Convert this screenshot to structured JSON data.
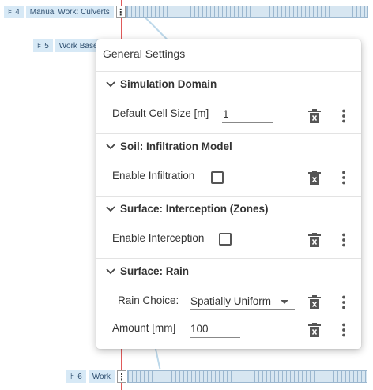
{
  "gantt": {
    "rows": [
      {
        "id": "row-4",
        "symbol": "⊧",
        "number": "4",
        "label": "Manual Work: Culverts"
      },
      {
        "id": "row-5",
        "symbol": "⊧",
        "number": "5",
        "label": "Work Base"
      },
      {
        "id": "row-6",
        "symbol": "⊧",
        "number": "6",
        "label": "Work"
      }
    ]
  },
  "panel": {
    "title": "General Settings",
    "sections": [
      {
        "title": "Simulation Domain",
        "fields": [
          {
            "label": "Default Cell Size [m]",
            "type": "input",
            "value": "1"
          }
        ]
      },
      {
        "title": "Soil: Infiltration Model",
        "fields": [
          {
            "label": "Enable Infiltration",
            "type": "checkbox",
            "checked": false
          }
        ]
      },
      {
        "title": "Surface: Interception (Zones)",
        "fields": [
          {
            "label": "Enable Interception",
            "type": "checkbox",
            "checked": false
          }
        ]
      },
      {
        "title": "Surface: Rain",
        "fields": [
          {
            "label": "Rain Choice:",
            "type": "select",
            "value": "Spatially Uniform"
          },
          {
            "label": "Amount [mm]",
            "type": "input",
            "value": "100"
          }
        ]
      }
    ],
    "icons": {
      "delete": "delete-icon",
      "more": "more-vert-icon",
      "expand": "chevron-down-icon"
    }
  }
}
